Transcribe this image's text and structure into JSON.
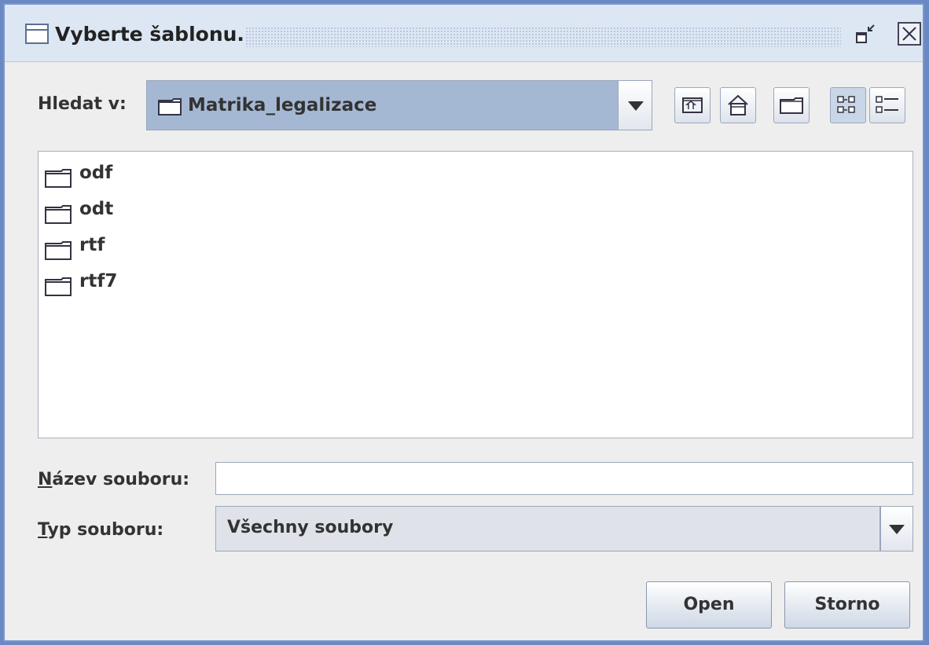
{
  "window": {
    "title": "Vyberte šablonu."
  },
  "look_in": {
    "label": "Hledat v:",
    "selected": "Matrika_legalizace"
  },
  "toolbar": {
    "buttons": [
      "up-folder-icon",
      "home-icon",
      "new-folder-icon",
      "list-view-icon",
      "details-view-icon"
    ]
  },
  "file_list": {
    "items": [
      {
        "name": "odf",
        "type": "folder"
      },
      {
        "name": "odt",
        "type": "folder"
      },
      {
        "name": "rtf",
        "type": "folder"
      },
      {
        "name": "rtf7",
        "type": "folder"
      }
    ]
  },
  "file_name": {
    "label_mnemonic": "N",
    "label_rest": "ázev souboru:",
    "value": ""
  },
  "file_type": {
    "label_mnemonic": "T",
    "label_rest": "yp souboru:",
    "selected": "Všechny soubory"
  },
  "buttons": {
    "open": "Open",
    "cancel": "Storno"
  }
}
